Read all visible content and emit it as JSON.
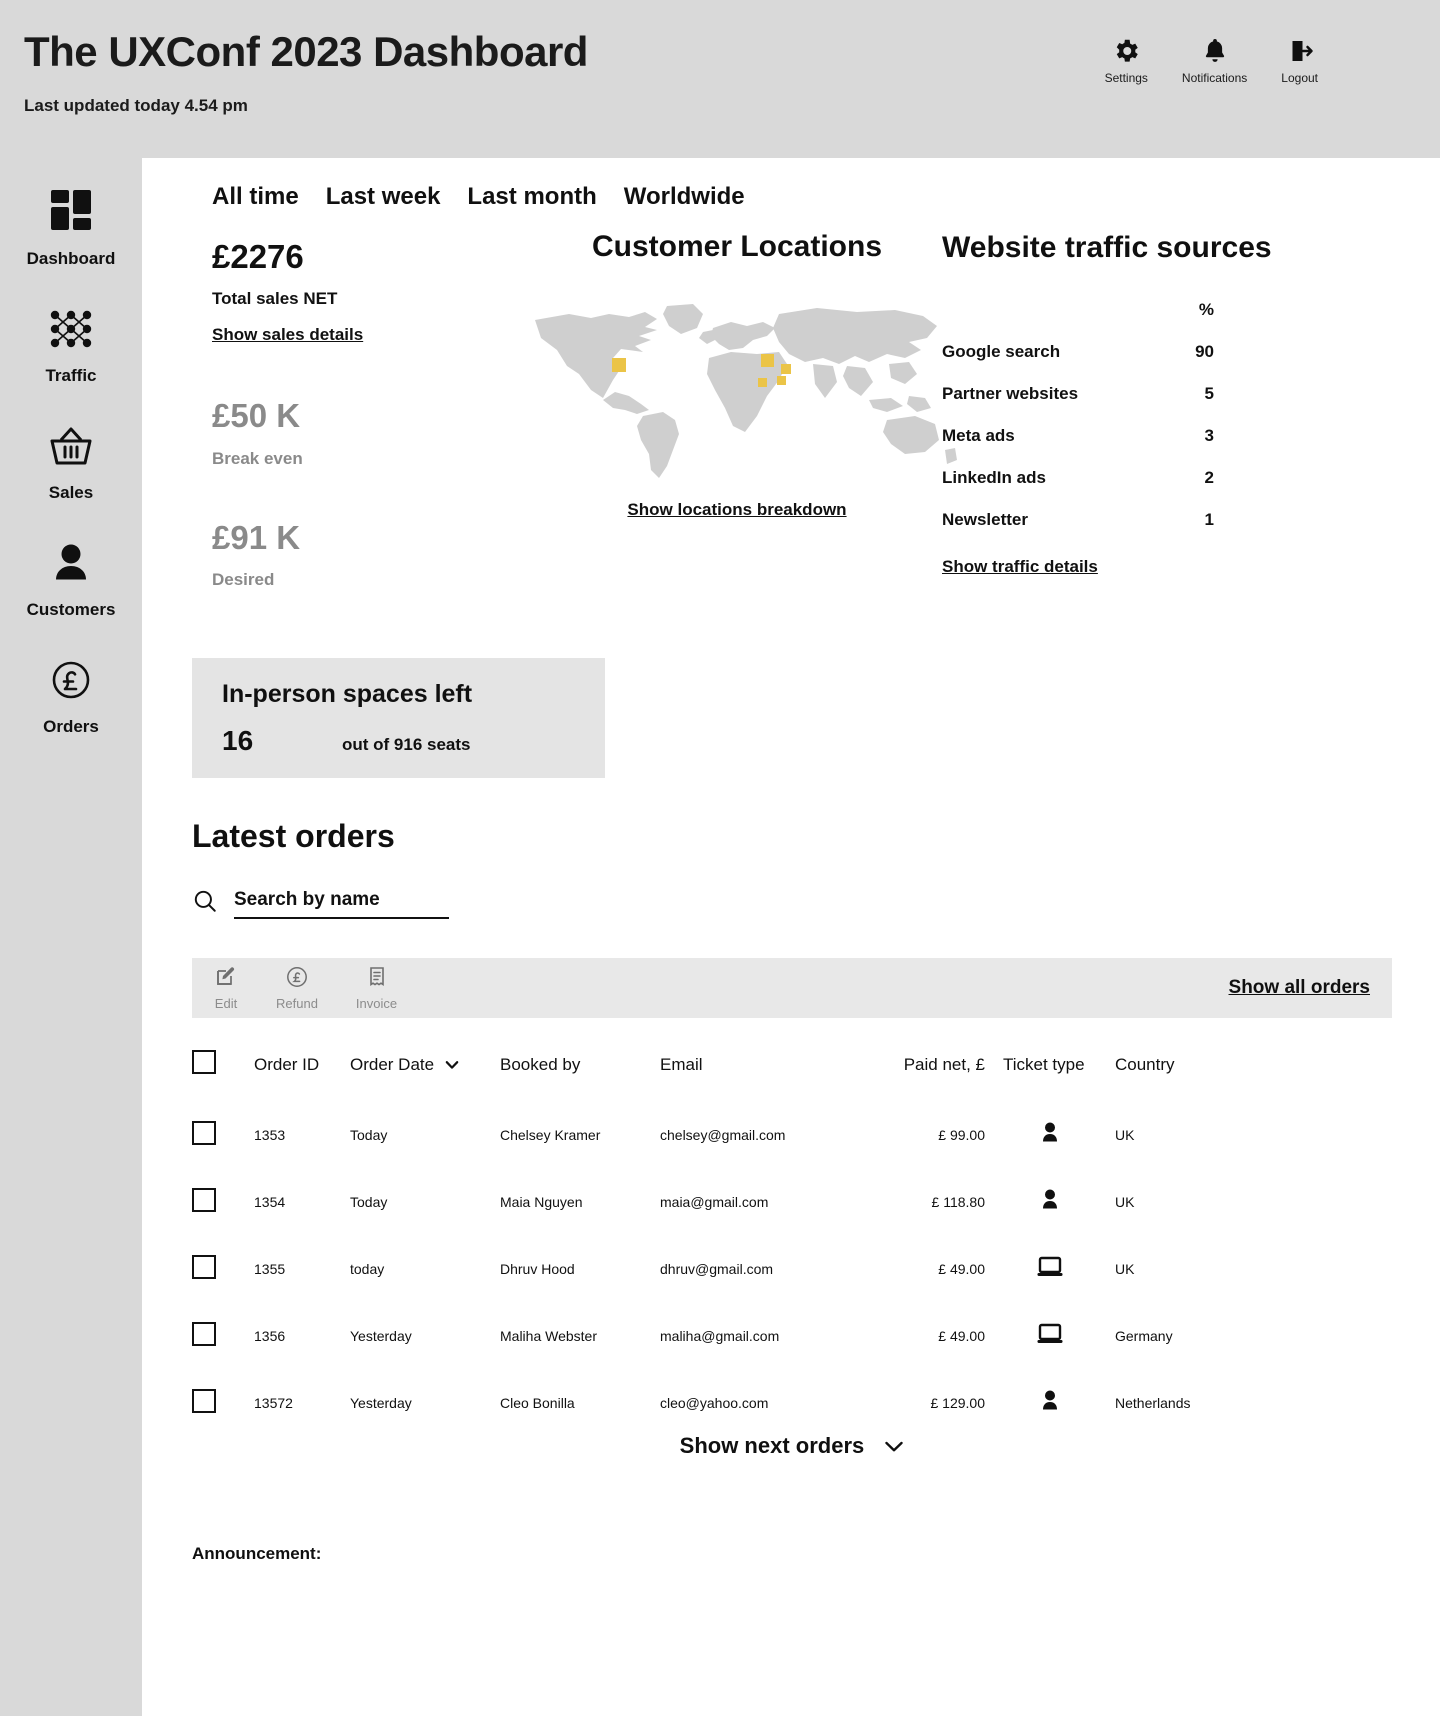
{
  "header": {
    "title": "The UXConf 2023 Dashboard",
    "subtitle": "Last updated today 4.54 pm",
    "actions": [
      {
        "label": "Settings",
        "icon": "gear-icon"
      },
      {
        "label": "Notifications",
        "icon": "bell-icon"
      },
      {
        "label": "Logout",
        "icon": "logout-icon"
      }
    ]
  },
  "sidebar": {
    "items": [
      {
        "label": "Dashboard",
        "icon": "grid-icon"
      },
      {
        "label": "Traffic",
        "icon": "network-icon"
      },
      {
        "label": "Sales",
        "icon": "basket-icon"
      },
      {
        "label": "Customers",
        "icon": "person-icon"
      },
      {
        "label": "Orders",
        "icon": "pound-circle-icon"
      }
    ]
  },
  "tabs": [
    {
      "label": "All time"
    },
    {
      "label": "Last week"
    },
    {
      "label": "Last month"
    },
    {
      "label": "Worldwide"
    }
  ],
  "stats": {
    "total_sales_value": "£2276",
    "total_sales_label": "Total sales NET",
    "sales_link": "Show sales details",
    "break_even_value": "£50 K",
    "break_even_label": "Break even",
    "desired_value": "£91 K",
    "desired_label": "Desired"
  },
  "map": {
    "title": "Customer Locations",
    "link": "Show locations breakdown",
    "land_color": "#cfcfcf",
    "marker_color": "#ebc447"
  },
  "traffic": {
    "title": "Website traffic sources",
    "pct_header": "%",
    "link": "Show traffic details",
    "rows": [
      {
        "source": "Google search",
        "pct": "90"
      },
      {
        "source": "Partner websites",
        "pct": "5"
      },
      {
        "source": "Meta ads",
        "pct": "3"
      },
      {
        "source": "LinkedIn ads",
        "pct": "2"
      },
      {
        "source": "Newsletter",
        "pct": "1"
      }
    ]
  },
  "spaces": {
    "title": "In-person spaces left",
    "count": "16",
    "out_of": "out of 916 seats"
  },
  "orders": {
    "section_title": "Latest orders",
    "search_placeholder": "Search by name",
    "search_value": "",
    "toolbar": [
      {
        "label": "Edit",
        "icon": "edit-icon"
      },
      {
        "label": "Refund",
        "icon": "pound-circle-icon"
      },
      {
        "label": "Invoice",
        "icon": "invoice-icon"
      }
    ],
    "show_all_label": "Show all orders",
    "columns": [
      "Order ID",
      "Order Date",
      "Booked by",
      "Email",
      "Paid net, £",
      "Ticket type",
      "Country"
    ],
    "sorted_column": "Order Date",
    "rows": [
      {
        "id": "1353",
        "date": "Today",
        "booked_by": "Chelsey Kramer",
        "email": "chelsey@gmail.com",
        "paid": "£ 99.00",
        "ticket": "in-person",
        "country": "UK"
      },
      {
        "id": "1354",
        "date": "Today",
        "booked_by": "Maia Nguyen",
        "email": "maia@gmail.com",
        "paid": "£ 118.80",
        "ticket": "in-person",
        "country": "UK"
      },
      {
        "id": "1355",
        "date": "today",
        "booked_by": "Dhruv Hood",
        "email": "dhruv@gmail.com",
        "paid": "£ 49.00",
        "ticket": "online",
        "country": "UK"
      },
      {
        "id": "1356",
        "date": "Yesterday",
        "booked_by": "Maliha Webster",
        "email": "maliha@gmail.com",
        "paid": "£ 49.00",
        "ticket": "online",
        "country": "Germany"
      },
      {
        "id": "13572",
        "date": "Yesterday",
        "booked_by": "Cleo Bonilla",
        "email": "cleo@yahoo.com",
        "paid": "£ 129.00",
        "ticket": "in-person",
        "country": "Netherlands"
      }
    ],
    "show_next_label": "Show next orders"
  },
  "footer": {
    "announcement": "Announcement:"
  },
  "colors": {
    "page_bg": "#d9d9d9",
    "panel_bg": "#ffffff",
    "accent": "#ebc447",
    "muted_text": "#8a8a8a"
  }
}
